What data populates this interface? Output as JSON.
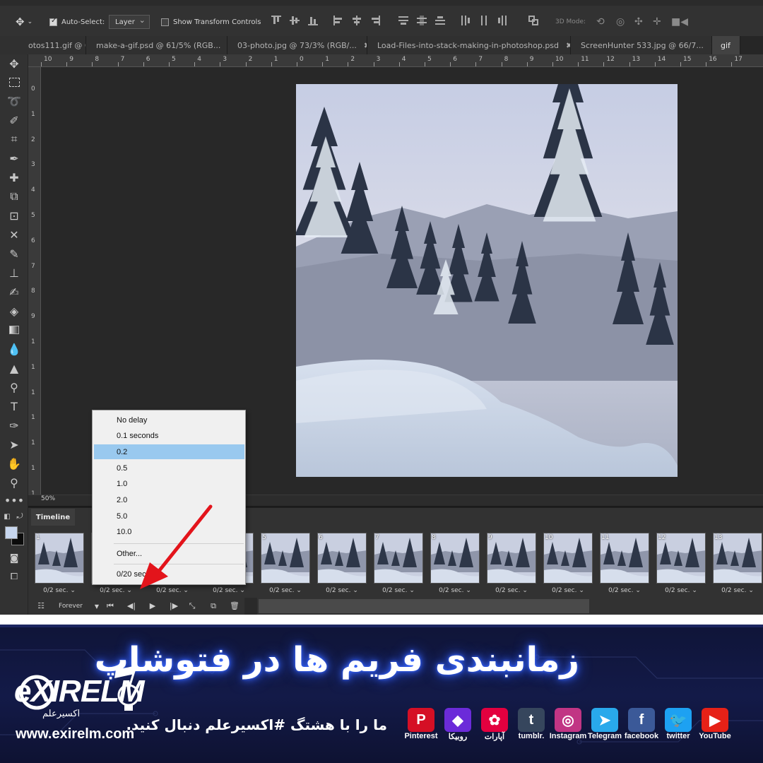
{
  "options_bar": {
    "auto_select_label": "Auto-Select:",
    "auto_select_target": "Layer",
    "transform_controls_label": "Show Transform Controls",
    "mode_3d_label": "3D Mode:"
  },
  "tabs": [
    {
      "label": "otos111.gif @ 6..."
    },
    {
      "label": "make-a-gif.psd @ 61/5% (RGB..."
    },
    {
      "label": "03-photo.jpg @ 73/3% (RGB/..."
    },
    {
      "label": "Load-Files-into-stack-making-in-photoshop.psd"
    },
    {
      "label": "ScreenHunter 533.jpg @ 66/7..."
    },
    {
      "label": "gif"
    }
  ],
  "ruler": {
    "h_labels": [
      "10",
      "9",
      "8",
      "7",
      "6",
      "5",
      "4",
      "3",
      "2",
      "1",
      "0",
      "1",
      "2",
      "3",
      "4",
      "5",
      "6",
      "7",
      "8",
      "9",
      "10",
      "11",
      "12",
      "13",
      "14",
      "15",
      "16",
      "17"
    ],
    "v_labels": [
      "0",
      "1",
      "2",
      "3",
      "4",
      "5",
      "6",
      "7",
      "8",
      "9",
      "1",
      "1",
      "1",
      "1",
      "1",
      "1",
      "1"
    ]
  },
  "zoom": "50%",
  "timeline": {
    "tab_label": "Timeline",
    "loop_option": "Forever",
    "frames": [
      {
        "num": "1",
        "delay": "0/2 sec."
      },
      {
        "num": "",
        "delay": "0/2 sec."
      },
      {
        "num": "",
        "delay": "0/2 sec."
      },
      {
        "num": "",
        "delay": "0/2 sec."
      },
      {
        "num": "5",
        "delay": "0/2 sec."
      },
      {
        "num": "6",
        "delay": "0/2 sec."
      },
      {
        "num": "7",
        "delay": "0/2 sec."
      },
      {
        "num": "8",
        "delay": "0/2 sec."
      },
      {
        "num": "9",
        "delay": "0/2 sec."
      },
      {
        "num": "10",
        "delay": "0/2 sec."
      },
      {
        "num": "11",
        "delay": "0/2 sec."
      },
      {
        "num": "12",
        "delay": "0/2 sec."
      },
      {
        "num": "13",
        "delay": "0/2 sec."
      }
    ]
  },
  "delay_menu": {
    "items": [
      "No delay",
      "0.1 seconds",
      "0.2",
      "0.5",
      "1.0",
      "2.0",
      "5.0",
      "10.0"
    ],
    "selected": "0.2",
    "other_label": "Other...",
    "current_label": "0/20 sec"
  },
  "banner": {
    "headline": "زمانبندی فریم ها در فتوشاپ",
    "subline": "ما را با هشتگ #اکسیرعلم دنبال کنید.",
    "logo_text": "eXIREL",
    "logo_text_b": "M",
    "logo_fa": "اکسیرعلم",
    "website": "www.exirelm.com",
    "social": [
      {
        "name": "Pinterest",
        "glyph": "P",
        "color": "#d50f25",
        "icon": "pinterest-icon"
      },
      {
        "name": "روبیکا",
        "glyph": "◆",
        "color": "#6b2bd9",
        "icon": "rubika-icon"
      },
      {
        "name": "آپارات",
        "glyph": "✿",
        "color": "#e3003f",
        "icon": "aparat-icon"
      },
      {
        "name": "tumblr.",
        "glyph": "t",
        "color": "#36465d",
        "icon": "tumblr-icon"
      },
      {
        "name": "Instagram",
        "glyph": "◎",
        "color": "#c13584",
        "icon": "instagram-icon"
      },
      {
        "name": "Telegram",
        "glyph": "➤",
        "color": "#29a9eb",
        "icon": "telegram-icon"
      },
      {
        "name": "facebook",
        "glyph": "f",
        "color": "#3b5998",
        "icon": "facebook-icon"
      },
      {
        "name": "twitter",
        "glyph": "🐦",
        "color": "#1da1f2",
        "icon": "twitter-icon"
      },
      {
        "name": "YouTube",
        "glyph": "▶",
        "color": "#e62117",
        "icon": "youtube-icon"
      }
    ]
  }
}
